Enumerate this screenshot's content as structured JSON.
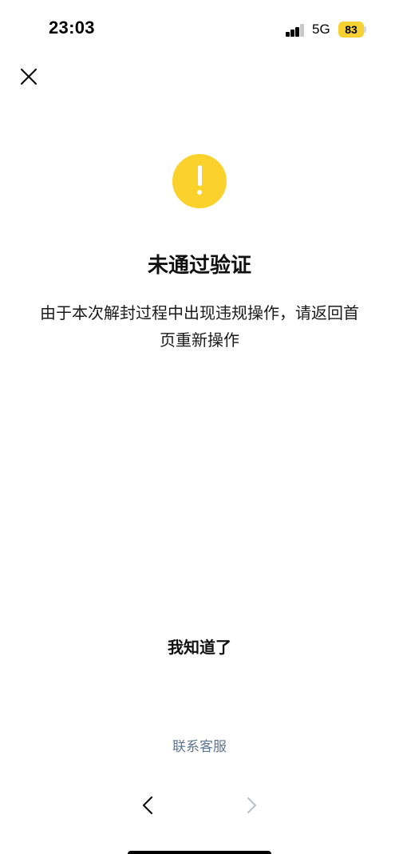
{
  "status_bar": {
    "time": "23:03",
    "network": "5G",
    "battery_level": "83",
    "signal_icon": "cellular-signal-icon",
    "battery_color": "#f7d131"
  },
  "header": {
    "close_icon": "close-icon"
  },
  "content": {
    "warning_icon": "exclamation-circle-icon",
    "warning_color": "#fbd22c",
    "title": "未通过验证",
    "message": "由于本次解封过程中出现违规操作，请返回首页重新操作"
  },
  "actions": {
    "acknowledge_label": "我知道了",
    "support_label": "联系客服",
    "support_color": "#5e7592"
  },
  "browser_nav": {
    "back_icon": "chevron-left-icon",
    "forward_icon": "chevron-right-icon"
  }
}
